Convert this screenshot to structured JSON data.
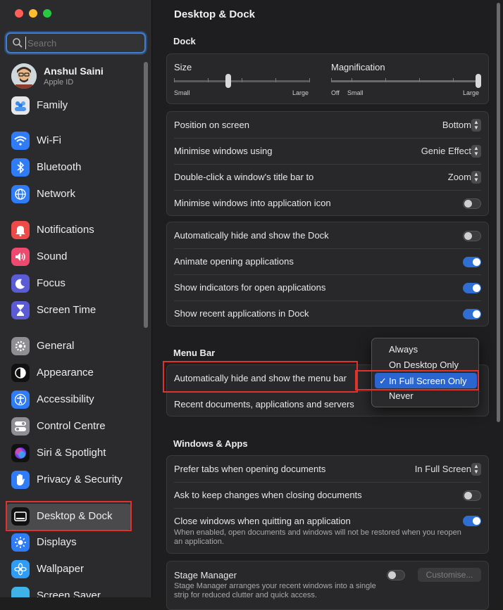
{
  "sidebar": {
    "search_placeholder": "Search",
    "account": {
      "name": "Anshul Saini",
      "subtitle": "Apple ID"
    },
    "items": [
      {
        "label": "Family",
        "icon": "family-icon"
      },
      {
        "label": "Wi-Fi",
        "icon": "wifi-icon"
      },
      {
        "label": "Bluetooth",
        "icon": "bluetooth-icon"
      },
      {
        "label": "Network",
        "icon": "globe-icon"
      },
      {
        "label": "Notifications",
        "icon": "bell-icon"
      },
      {
        "label": "Sound",
        "icon": "speaker-icon"
      },
      {
        "label": "Focus",
        "icon": "moon-icon"
      },
      {
        "label": "Screen Time",
        "icon": "hourglass-icon"
      },
      {
        "label": "General",
        "icon": "gear-icon"
      },
      {
        "label": "Appearance",
        "icon": "appearance-icon"
      },
      {
        "label": "Accessibility",
        "icon": "accessibility-icon"
      },
      {
        "label": "Control Centre",
        "icon": "toggles-icon"
      },
      {
        "label": "Siri & Spotlight",
        "icon": "siri-icon"
      },
      {
        "label": "Privacy & Security",
        "icon": "hand-icon"
      },
      {
        "label": "Desktop & Dock",
        "icon": "dock-icon"
      },
      {
        "label": "Displays",
        "icon": "sun-icon"
      },
      {
        "label": "Wallpaper",
        "icon": "flower-icon"
      },
      {
        "label": "Screen Saver",
        "icon": "screensaver-icon"
      }
    ],
    "selected": "Desktop & Dock"
  },
  "main": {
    "title": "Desktop & Dock",
    "dock_heading": "Dock",
    "size": {
      "label": "Size",
      "min": "Small",
      "max": "Large",
      "value": 0.4
    },
    "magnification": {
      "label": "Magnification",
      "off": "Off",
      "min": "Small",
      "max": "Large",
      "value": 1.0
    },
    "dock_rows": [
      {
        "label": "Position on screen",
        "value": "Bottom"
      },
      {
        "label": "Minimise windows using",
        "value": "Genie Effect"
      },
      {
        "label": "Double-click a window's title bar to",
        "value": "Zoom"
      },
      {
        "label": "Minimise windows into application icon",
        "toggle": false
      }
    ],
    "dock_toggles": [
      {
        "label": "Automatically hide and show the Dock",
        "toggle": false
      },
      {
        "label": "Animate opening applications",
        "toggle": true
      },
      {
        "label": "Show indicators for open applications",
        "toggle": true
      },
      {
        "label": "Show recent applications in Dock",
        "toggle": true
      }
    ],
    "menubar_heading": "Menu Bar",
    "menubar_rows": [
      {
        "label": "Automatically hide and show the menu bar"
      },
      {
        "label": "Recent documents, applications and servers"
      }
    ],
    "menu_options": [
      "Always",
      "On Desktop Only",
      "In Full Screen Only",
      "Never"
    ],
    "menu_selected": "In Full Screen Only",
    "checkmark": "✓",
    "windows_heading": "Windows & Apps",
    "windows_rows": [
      {
        "label": "Prefer tabs when opening documents",
        "value": "In Full Screen"
      },
      {
        "label": "Ask to keep changes when closing documents",
        "toggle": false
      },
      {
        "label": "Close windows when quitting an application",
        "toggle": true,
        "desc": "When enabled, open documents and windows will not be restored when you reopen an application."
      }
    ],
    "stage": {
      "label": "Stage Manager",
      "button": "Customise...",
      "toggle": false,
      "desc": "Stage Manager arranges your recent windows into a single strip for reduced clutter and quick access."
    }
  },
  "colors": {
    "accent": "#2f6fd3",
    "highlight_box": "#e0332e"
  }
}
